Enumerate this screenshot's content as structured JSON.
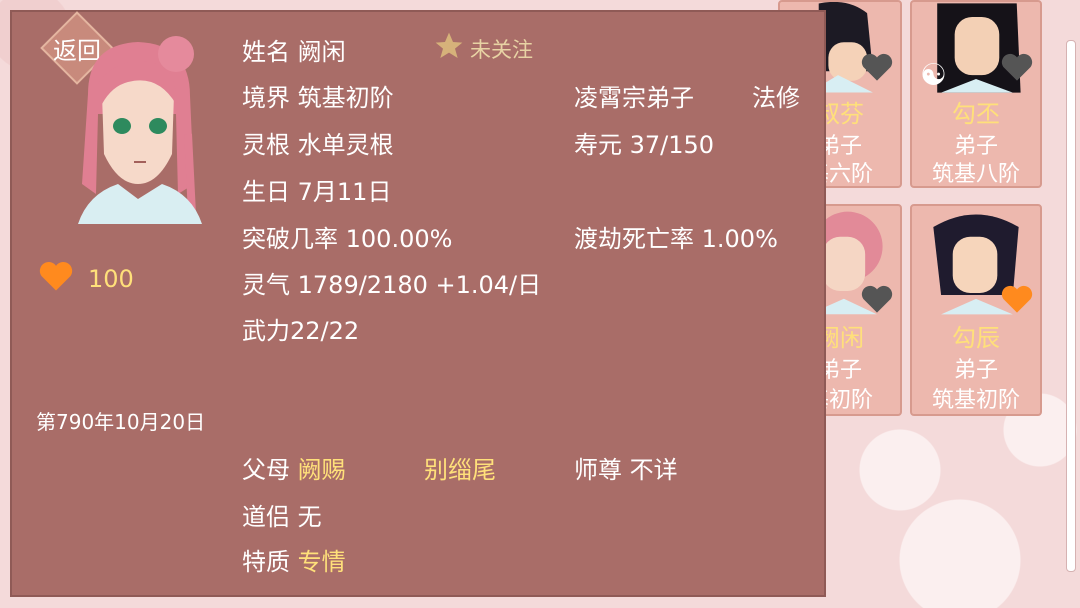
{
  "panel": {
    "back_label": "返回",
    "name_label": "姓名",
    "name_value": "阙闲",
    "follow_label": "未关注",
    "realm_label": "境界",
    "realm_value": "筑基初阶",
    "sect_value": "凌霄宗弟子",
    "class_value": "法修",
    "root_label": "灵根",
    "root_value": "水单灵根",
    "lifespan_label": "寿元",
    "lifespan_value": "37/150",
    "birthday_label": "生日",
    "birthday_value": "7月11日",
    "breakthrough_label": "突破几率",
    "breakthrough_value": "100.00%",
    "tribulation_label": "渡劫死亡率",
    "tribulation_value": "1.00%",
    "qi_label": "灵气",
    "qi_value": "1789/2180 +1.04/日",
    "force_text": "武力22/22",
    "affection_value": "100",
    "date_text": "第790年10月20日",
    "parents_label": "父母",
    "parent1": "阙赐",
    "parent2": "别缁尾",
    "master_label": "师尊",
    "master_value": "不详",
    "partner_label": "道侣",
    "partner_value": "无",
    "trait_label": "特质",
    "trait_value": "专情"
  },
  "cards": [
    {
      "name": "叔芬",
      "rank": "弟子",
      "level": "基六阶"
    },
    {
      "name": "勾丕",
      "rank": "弟子",
      "level": "筑基八阶"
    },
    {
      "name": "阙闲",
      "rank": "弟子",
      "level": "基初阶"
    },
    {
      "name": "勾辰",
      "rank": "弟子",
      "level": "筑基初阶"
    }
  ],
  "colors": {
    "panel": "#a96d68",
    "gold": "#ffe07a",
    "heart": "#ff8a1e"
  }
}
